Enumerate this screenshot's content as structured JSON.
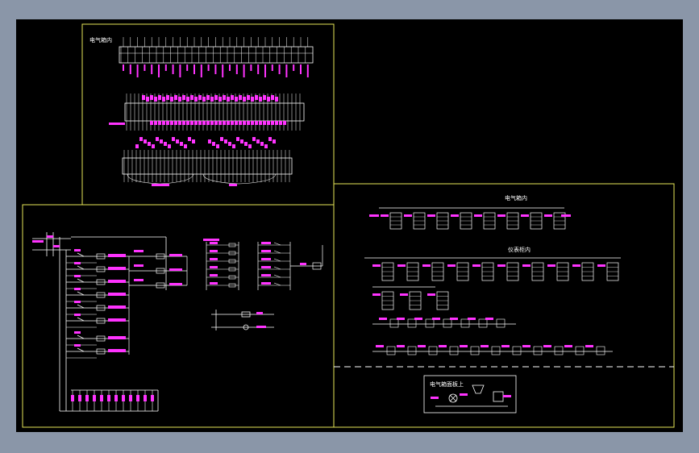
{
  "colors": {
    "viewport_bg": "#8a96a8",
    "canvas_bg": "#000000",
    "frame": "#e6e657",
    "wire": "#ffffff",
    "tag": "#ff33ff"
  },
  "top_left": {
    "title": "电气箱内"
  },
  "right": {
    "box_title": "电气箱内",
    "cabinet_title": "仪表柜内",
    "lid_title": "电气箱面板上"
  }
}
